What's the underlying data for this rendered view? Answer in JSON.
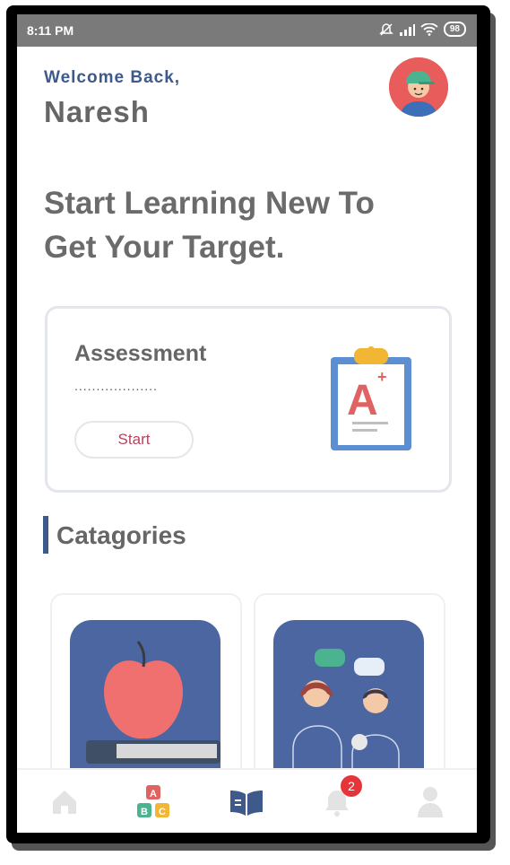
{
  "status_bar": {
    "time": "8:11 PM",
    "battery": "98"
  },
  "header": {
    "welcome": "Welcome Back,",
    "username": "Naresh"
  },
  "headline": "Start Learning New To Get Your Target.",
  "assessment": {
    "title": "Assessment",
    "dots": "...................",
    "start_label": "Start",
    "clipboard_grade": "A",
    "clipboard_plus": "+"
  },
  "categories": {
    "title": "Catagories"
  },
  "nav": {
    "notification_count": "2",
    "abc_letters": [
      "A",
      "B",
      "C"
    ]
  },
  "colors": {
    "accent": "#3e5a8a",
    "start_text": "#b7435c",
    "badge": "#e5353b"
  }
}
